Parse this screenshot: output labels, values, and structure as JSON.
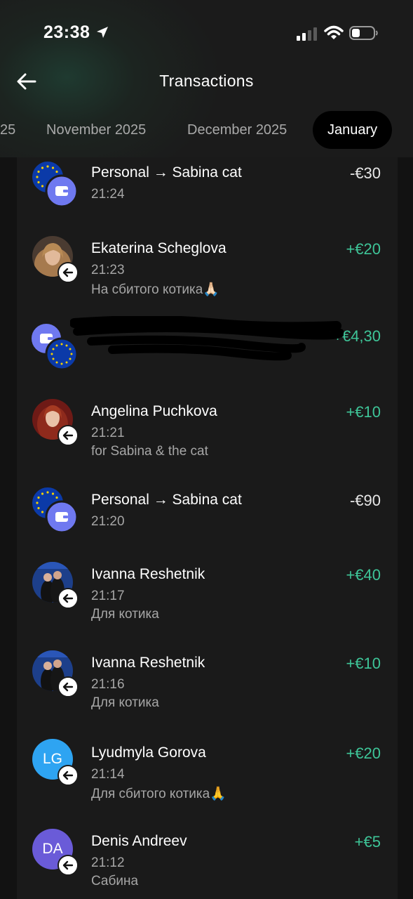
{
  "status_bar": {
    "time": "23:38"
  },
  "header": {
    "title": "Transactions"
  },
  "tabs": [
    {
      "label": "25"
    },
    {
      "label": "November 2025"
    },
    {
      "label": "December 2025"
    },
    {
      "label": "January"
    }
  ],
  "colors": {
    "positive_amount": "#3ec598",
    "negative_amount": "#e8e8e8",
    "background": "#1a1a1a",
    "wallet_icon": "#6f79f0",
    "eu_flag": "#0b3aa8"
  },
  "transactions": [
    {
      "name": "Personal → Sabina cat",
      "time": "21:24",
      "note": "",
      "amount": "-€30",
      "icon": "eu-flag-wallet-icon"
    },
    {
      "name": "Ekaterina Scheglova",
      "time": "21:23",
      "note": "На сбитого котика🙏🏻",
      "amount": "+€20",
      "icon": "user-photo"
    },
    {
      "name": "",
      "time": "",
      "note": "",
      "amount": "+€4,30",
      "icon": "wallet-eu-flag-icon"
    },
    {
      "name": "Angelina Puchkova",
      "time": "21:21",
      "note": "for Sabina & the cat",
      "amount": "+€10",
      "icon": "user-photo"
    },
    {
      "name": "Personal → Sabina cat",
      "time": "21:20",
      "note": "",
      "amount": "-€90",
      "icon": "eu-flag-wallet-icon"
    },
    {
      "name": "Ivanna Reshetnik",
      "time": "21:17",
      "note": "Для котика",
      "amount": "+€40",
      "icon": "user-photo"
    },
    {
      "name": "Ivanna Reshetnik",
      "time": "21:16",
      "note": "Для котика",
      "amount": "+€10",
      "icon": "user-photo"
    },
    {
      "name": "Lyudmyla Gorova",
      "time": "21:14",
      "note": "Для сбитого котика🙏",
      "amount": "+€20",
      "icon": "initials",
      "initials": "LG"
    },
    {
      "name": "Denis Andreev",
      "time": "21:12",
      "note": "Сабина",
      "amount": "+€5",
      "icon": "initials",
      "initials": "DA"
    }
  ]
}
